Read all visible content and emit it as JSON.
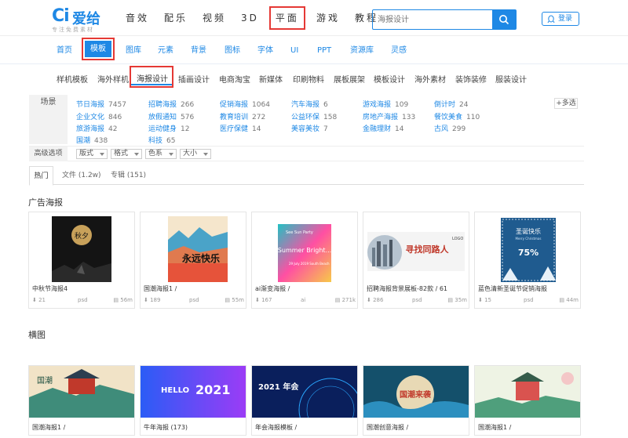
{
  "brand": {
    "mark": "Ci",
    "name": "爱给",
    "slogan": "专注免费素材"
  },
  "main_nav": [
    "音效",
    "配乐",
    "视频",
    "3D",
    "平面",
    "游戏",
    "教程"
  ],
  "main_nav_active": "平面",
  "search": {
    "placeholder": "海报设计"
  },
  "login_label": "登录",
  "categories": [
    "首页",
    "模板",
    "图库",
    "元素",
    "背景",
    "图标",
    "字体",
    "UI",
    "PPT",
    "资源库",
    "灵感"
  ],
  "category_active": "模板",
  "sub_nav": [
    "样机模板",
    "海外样机",
    "海报设计",
    "插画设计",
    "电商淘宝",
    "新媒体",
    "印刷物料",
    "展板展架",
    "模板设计",
    "海外素材",
    "装饰装修",
    "服装设计"
  ],
  "sub_nav_active": "海报设计",
  "filter": {
    "label": "场景",
    "tags": [
      {
        "name": "节日海报",
        "count": "7457"
      },
      {
        "name": "招聘海报",
        "count": "266"
      },
      {
        "name": "促销海报",
        "count": "1064"
      },
      {
        "name": "汽车海报",
        "count": "6"
      },
      {
        "name": "游戏海报",
        "count": "109"
      },
      {
        "name": "倒计时",
        "count": "24"
      },
      {
        "name": "企业文化",
        "count": "846"
      },
      {
        "name": "放假通知",
        "count": "576"
      },
      {
        "name": "教育培训",
        "count": "272"
      },
      {
        "name": "公益环保",
        "count": "158"
      },
      {
        "name": "房地产海报",
        "count": "133"
      },
      {
        "name": "餐饮美食",
        "count": "110"
      },
      {
        "name": "旅游海报",
        "count": "42"
      },
      {
        "name": "运动健身",
        "count": "12"
      },
      {
        "name": "医疗保健",
        "count": "14"
      },
      {
        "name": "美容美妆",
        "count": "7"
      },
      {
        "name": "金融理财",
        "count": "14"
      },
      {
        "name": "古风",
        "count": "299"
      },
      {
        "name": "国潮",
        "count": "438"
      },
      {
        "name": "科技",
        "count": "65"
      }
    ],
    "more_label": "+多选"
  },
  "advanced": {
    "label": "高级选项",
    "dropdowns": [
      "版式",
      "格式",
      "色系",
      "大小"
    ]
  },
  "tabs": [
    "热门",
    "文件 (1.2w)",
    "专辑 (151)"
  ],
  "section1": {
    "title": "广告海报",
    "cards": [
      {
        "title": "中秋节海报4",
        "downloads": "21",
        "format": "psd",
        "size": "56m"
      },
      {
        "title": "国潮海报1 /",
        "downloads": "189",
        "format": "psd",
        "size": "55m"
      },
      {
        "title": "ai渐变海报 /",
        "downloads": "167",
        "format": "ai",
        "size": "271k"
      },
      {
        "title": "招聘海报背景展板-82款 / 61",
        "downloads": "286",
        "format": "psd",
        "size": "35m"
      },
      {
        "title": "蓝色清新圣诞节促销海报",
        "downloads": "15",
        "format": "psd",
        "size": "44m"
      }
    ]
  },
  "section2": {
    "title": "横图",
    "cards": [
      {
        "title": "国潮海报1 /"
      },
      {
        "title": "牛年海报 (173)"
      },
      {
        "title": "年会海报模板 /"
      },
      {
        "title": "国潮创意海报 /"
      },
      {
        "title": "国潮海报1 /"
      }
    ]
  },
  "thumb_text": {
    "autumn": "秋夕",
    "guochao": "永远快乐",
    "summer_top": "See Sun Party",
    "summer": "Summer Bright...",
    "summer_date": "29 July 2019 South Beach",
    "recruit": "寻找同路人",
    "recruit_logo": "LOGO",
    "xmas": "圣诞快乐",
    "xmas_sub": "Merry Christmas",
    "xmas_price": "75%",
    "hello": "HELLO",
    "year": "2021",
    "annual": "2021 年会",
    "chao": "国潮来袭",
    "chao2": "国潮"
  },
  "colors": {
    "accent": "#1e88e5",
    "highlight_box": "#e53935"
  }
}
